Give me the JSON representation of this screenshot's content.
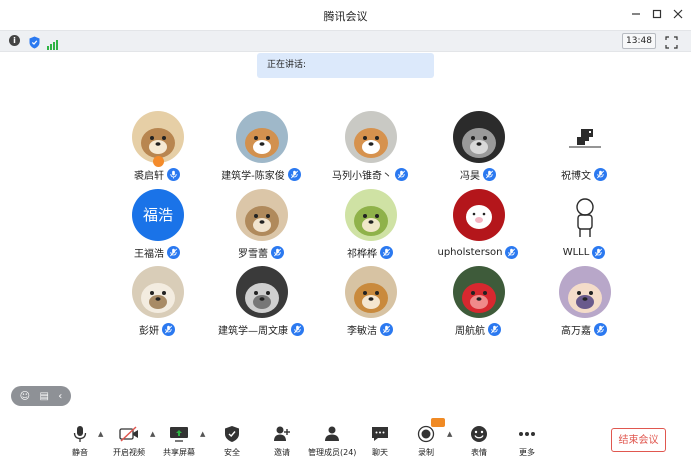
{
  "window": {
    "title": "腾讯会议"
  },
  "infobar": {
    "time": "13:48"
  },
  "speaking": {
    "label": "正在讲话:"
  },
  "participants": [
    {
      "name": "裘启轩",
      "avatar": "golden-retriever-puppy",
      "host": true
    },
    {
      "name": "建筑学-陈家俊",
      "avatar": "shiba-dog"
    },
    {
      "name": "马列小锥奇丶",
      "avatar": "shiba-dog-smiling"
    },
    {
      "name": "冯昊",
      "avatar": "anime-character"
    },
    {
      "name": "祝博文",
      "avatar": "dinosaur-sketch"
    },
    {
      "name": "王福浩",
      "avatar_text": "福浩"
    },
    {
      "name": "罗雪蕾",
      "avatar": "sleeping-puppy"
    },
    {
      "name": "祁桦桦",
      "avatar": "green-cat"
    },
    {
      "name": "upholsterson",
      "avatar": "pink-cartoon-pig"
    },
    {
      "name": "WLLL",
      "avatar": "astronaut-sketch"
    },
    {
      "name": "彭妍",
      "avatar": "fluffy-white-puppy"
    },
    {
      "name": "建筑学—周文康",
      "avatar": "ink-sketch"
    },
    {
      "name": "李敏洁",
      "avatar": "shiba-puppy-flower"
    },
    {
      "name": "周航航",
      "avatar": "red-flowers"
    },
    {
      "name": "高万嘉",
      "avatar": "anime-boy"
    }
  ],
  "toolbar": {
    "mute": "静音",
    "video": "开启视频",
    "share": "共享屏幕",
    "security": "安全",
    "invite": "邀请",
    "members": "管理成员(24)",
    "chat": "聊天",
    "record": "录制",
    "emoji": "表情",
    "more": "更多",
    "end": "结束会议"
  },
  "colors": {
    "accent": "#2b79f0",
    "danger": "#e0574f",
    "speaking_bg": "#dce9fb"
  }
}
